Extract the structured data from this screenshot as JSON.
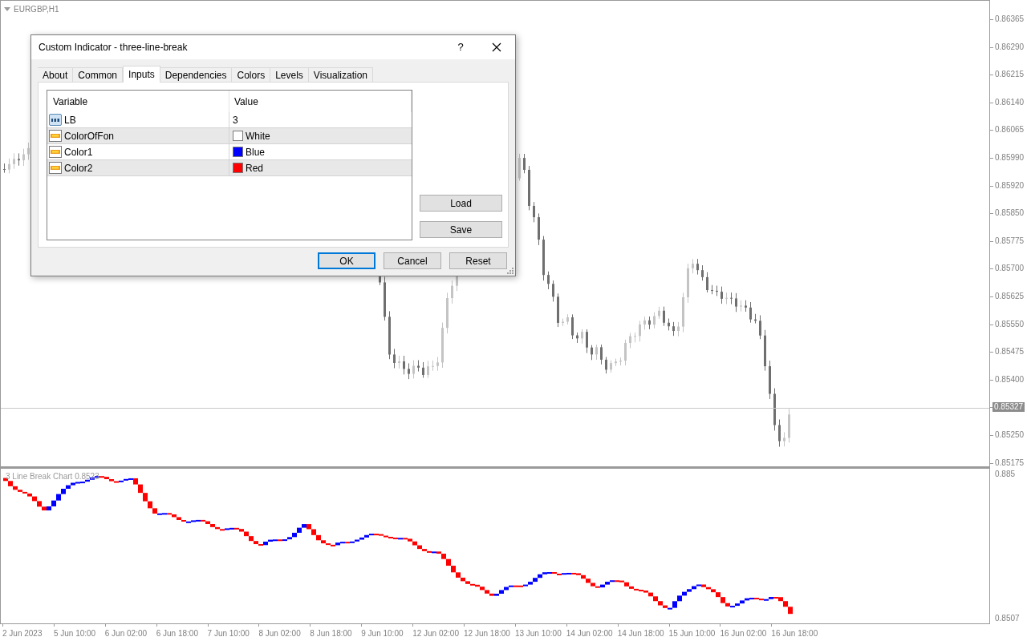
{
  "chart": {
    "symbol": "EURGBP,H1"
  },
  "price_axis": [
    {
      "label": "0.86365",
      "current": false
    },
    {
      "label": "0.86290",
      "current": false
    },
    {
      "label": "0.86215",
      "current": false
    },
    {
      "label": "0.86140",
      "current": false
    },
    {
      "label": "0.86065",
      "current": false
    },
    {
      "label": "0.85990",
      "current": false
    },
    {
      "label": "0.85920",
      "current": false
    },
    {
      "label": "0.85850",
      "current": false
    },
    {
      "label": "0.85775",
      "current": false
    },
    {
      "label": "0.85700",
      "current": false
    },
    {
      "label": "0.85625",
      "current": false
    },
    {
      "label": "0.85550",
      "current": false
    },
    {
      "label": "0.85475",
      "current": false
    },
    {
      "label": "0.85400",
      "current": false
    },
    {
      "label": "0.85327",
      "current": true
    },
    {
      "label": "0.85250",
      "current": false
    },
    {
      "label": "0.85175",
      "current": false
    }
  ],
  "indicator": {
    "label": "3 Line Break Chart 0.8523",
    "axis": [
      "0.885",
      "0.8507"
    ]
  },
  "time_axis": [
    "2 Jun 2023",
    "5 Jun 10:00",
    "6 Jun 02:00",
    "6 Jun 18:00",
    "7 Jun 10:00",
    "8 Jun 02:00",
    "8 Jun 18:00",
    "9 Jun 10:00",
    "12 Jun 02:00",
    "12 Jun 18:00",
    "13 Jun 10:00",
    "14 Jun 02:00",
    "14 Jun 18:00",
    "15 Jun 10:00",
    "16 Jun 02:00",
    "16 Jun 18:00"
  ],
  "dialog": {
    "title": "Custom Indicator - three-line-break",
    "help": "?",
    "tabs": [
      {
        "label": "About",
        "selected": false
      },
      {
        "label": "Common",
        "selected": false
      },
      {
        "label": "Inputs",
        "selected": true
      },
      {
        "label": "Dependencies",
        "selected": false
      },
      {
        "label": "Colors",
        "selected": false
      },
      {
        "label": "Levels",
        "selected": false
      },
      {
        "label": "Visualization",
        "selected": false
      }
    ],
    "columns": [
      "Variable",
      "Value"
    ],
    "rows": [
      {
        "kind": "int",
        "variable": "LB",
        "value": "3"
      },
      {
        "kind": "color",
        "variable": "ColorOfFon",
        "value": "White",
        "color": "#ffffff"
      },
      {
        "kind": "color",
        "variable": "Color1",
        "value": "Blue",
        "color": "#0000ff"
      },
      {
        "kind": "color",
        "variable": "Color2",
        "value": "Red",
        "color": "#ff0000"
      }
    ],
    "side_buttons": [
      "Load",
      "Save"
    ],
    "buttons": [
      {
        "label": "OK",
        "default": true
      },
      {
        "label": "Cancel",
        "default": false
      },
      {
        "label": "Reset",
        "default": false
      }
    ]
  }
}
